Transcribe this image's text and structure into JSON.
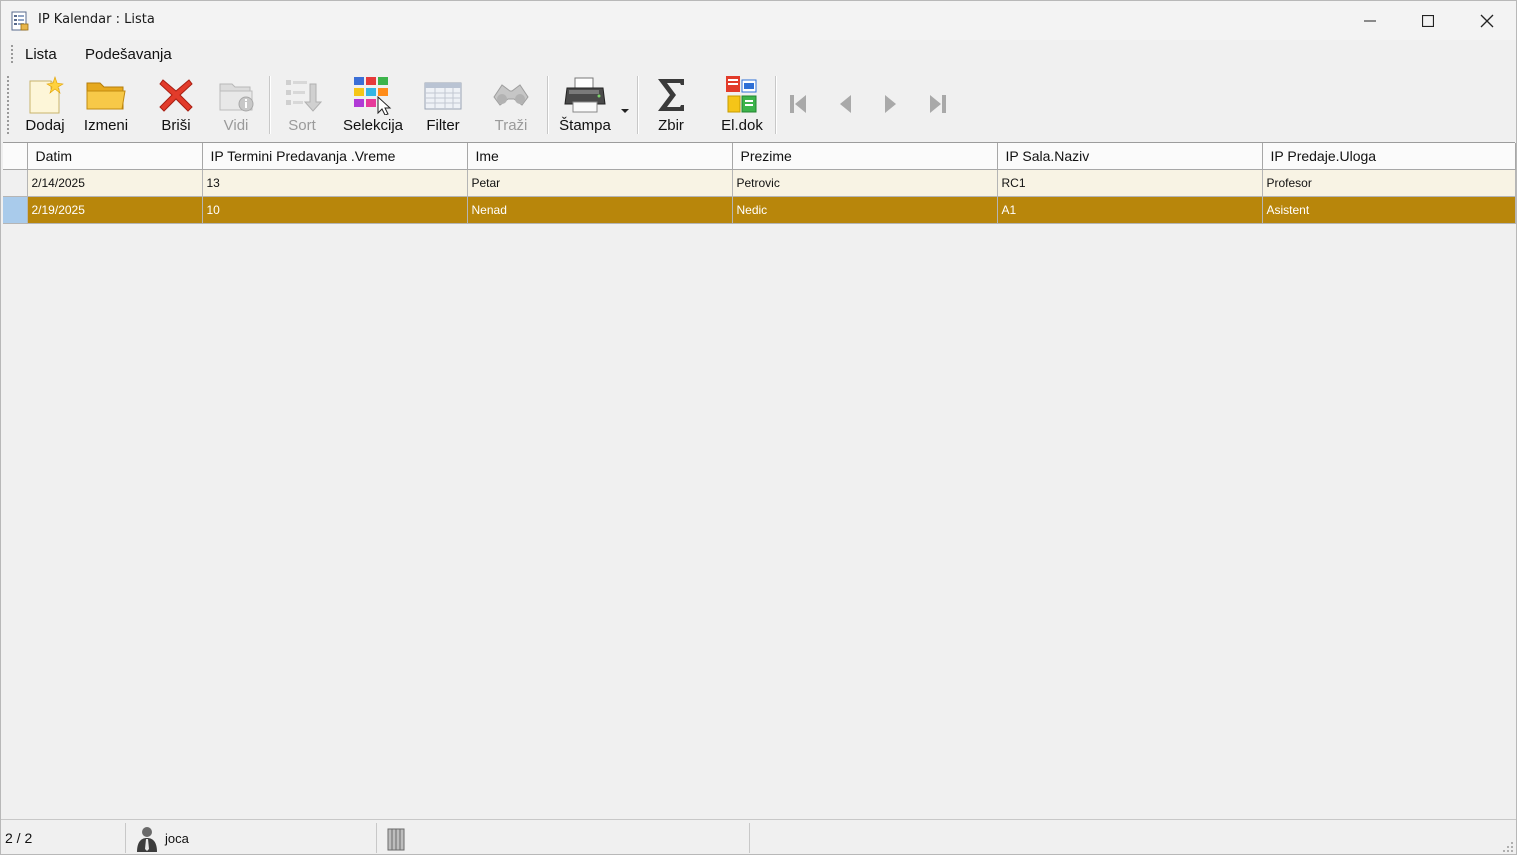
{
  "window": {
    "title": "IP Kalendar : Lista"
  },
  "menu": {
    "items": [
      "Lista",
      "Podešavanja"
    ]
  },
  "toolbar": {
    "dodaj": "Dodaj",
    "izmeni": "Izmeni",
    "brisi": "Briši",
    "vidi": "Vidi",
    "sort": "Sort",
    "selekcija": "Selekcija",
    "filter": "Filter",
    "trazi": "Traži",
    "stampa": "Štampa",
    "zbir": "Zbir",
    "eldok": "El.dok"
  },
  "table": {
    "columns": [
      "Datim",
      "IP Termini Predavanja .Vreme",
      "Ime",
      "Prezime",
      "IP Sala.Naziv",
      "IP Predaje.Uloga"
    ],
    "rows": [
      [
        "2/14/2025",
        "13",
        "Petar",
        "Petrovic",
        "RC1",
        "Profesor"
      ],
      [
        "2/19/2025",
        "10",
        "Nenad",
        "Nedic",
        "A1",
        "Asistent"
      ]
    ],
    "selected_row": 2
  },
  "status": {
    "position": "2 / 2",
    "user": "joca"
  },
  "colors": {
    "selected_row": "#b8860b",
    "row_alt": "#f8f3e4",
    "indicator_selected": "#a9cbeb"
  }
}
